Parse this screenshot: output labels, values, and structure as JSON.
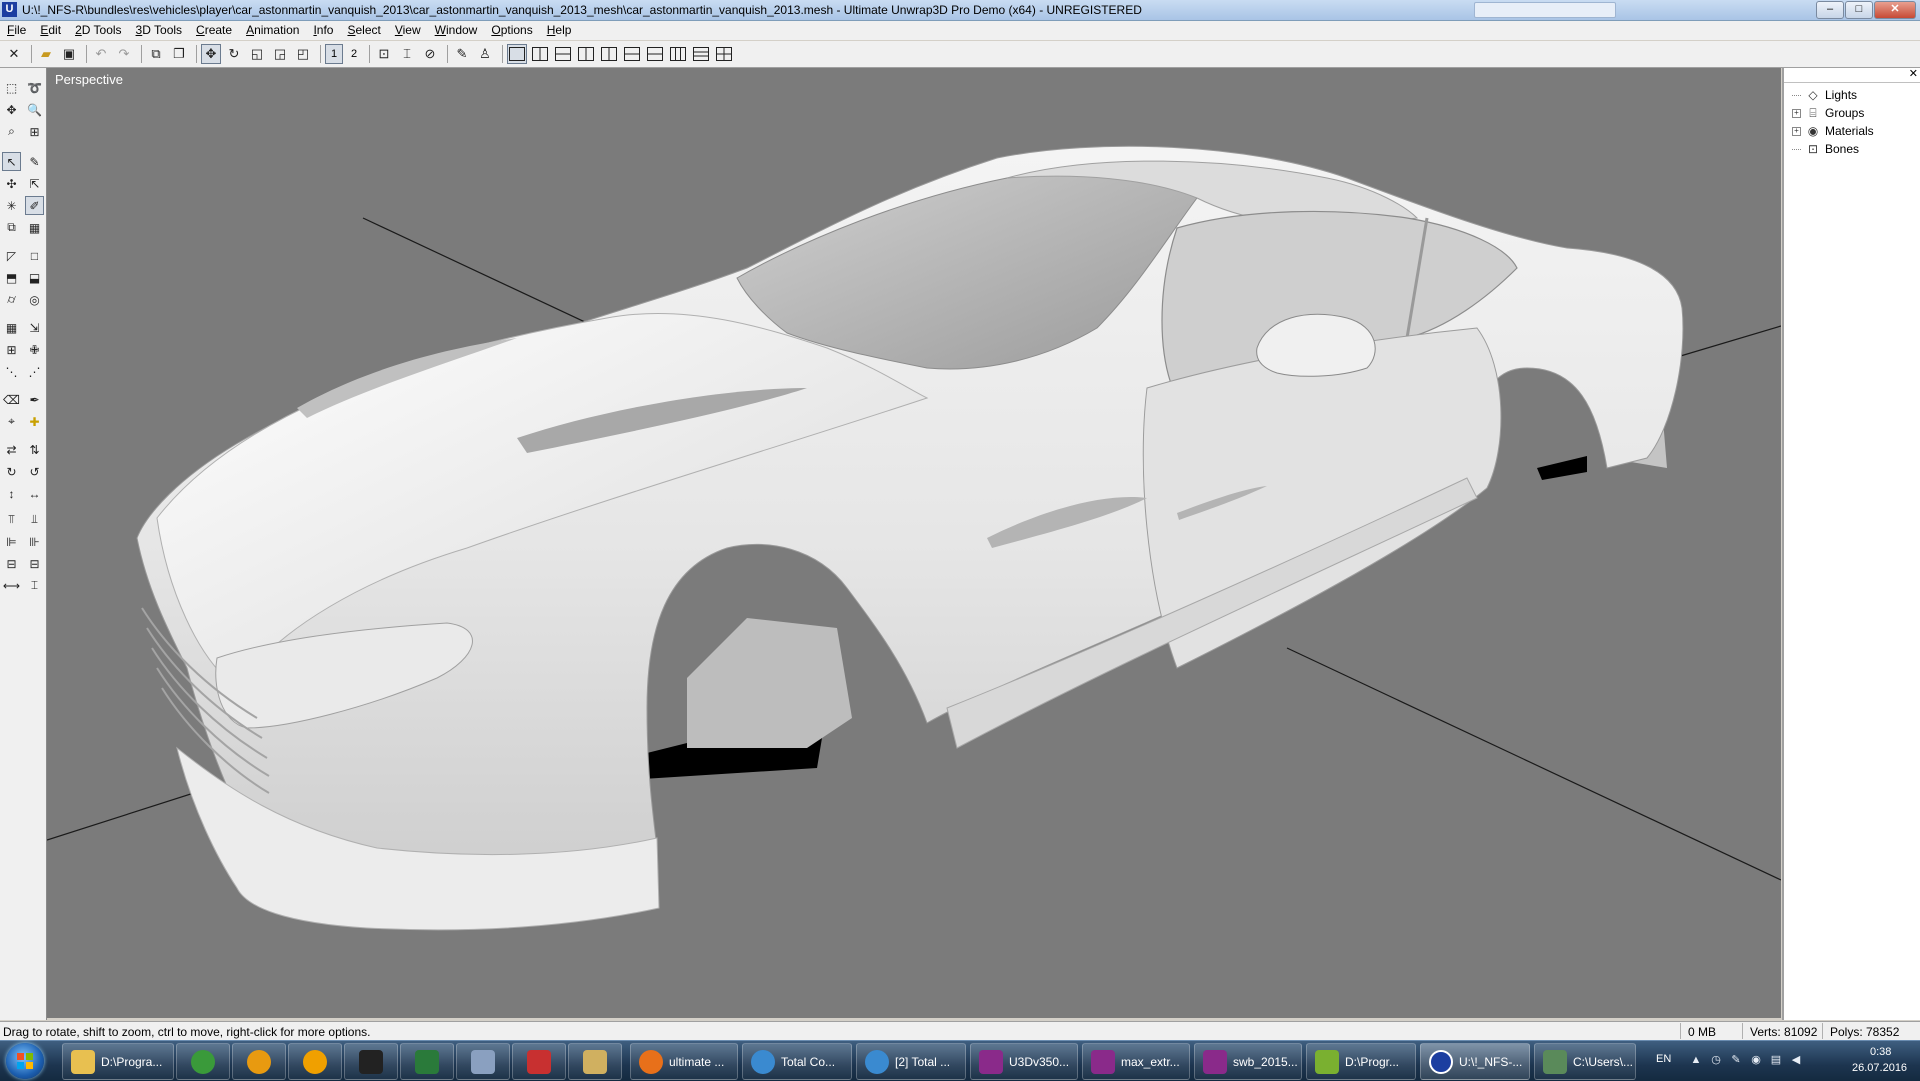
{
  "window": {
    "title": "U:\\!_NFS-R\\bundles\\res\\vehicles\\player\\car_astonmartin_vanquish_2013\\car_astonmartin_vanquish_2013_mesh\\car_astonmartin_vanquish_2013.mesh - Ultimate Unwrap3D Pro Demo (x64) - UNREGISTERED",
    "icon_letter": "U",
    "controls": {
      "minimize": "–",
      "maximize": "□",
      "close": "✕"
    }
  },
  "menu": [
    "File",
    "Edit",
    "2D Tools",
    "3D Tools",
    "Create",
    "Animation",
    "Info",
    "Select",
    "View",
    "Window",
    "Options",
    "Help"
  ],
  "toolbar": {
    "view_numbers": [
      "1",
      "2"
    ],
    "icons": [
      "new-icon",
      "open-icon",
      "save-icon",
      "undo-icon",
      "redo-icon",
      "export-icon",
      "copy-icon",
      "move-icon",
      "rotate-icon",
      "scale-icon",
      "scale-uniform-icon",
      "transform-icon"
    ]
  },
  "viewport": {
    "label": "Perspective",
    "background": "#7b7b7b",
    "model": "car_astonmartin_vanquish_2013 (white shaded body)"
  },
  "scene_tree": {
    "close": "✕",
    "items": [
      {
        "label": "Lights",
        "icon": "light-icon",
        "expandable": false
      },
      {
        "label": "Groups",
        "icon": "groups-icon",
        "expandable": true
      },
      {
        "label": "Materials",
        "icon": "materials-icon",
        "expandable": true
      },
      {
        "label": "Bones",
        "icon": "bones-icon",
        "expandable": false
      }
    ]
  },
  "status": {
    "hint": "Drag to rotate, shift to zoom, ctrl to move, right-click for more options.",
    "memory": "0 MB",
    "verts": "Verts: 81092",
    "polys": "Polys: 78352"
  },
  "taskbar": {
    "tasks": [
      {
        "label": "D:\\Progra...",
        "color": "#e8c050"
      },
      {
        "label": "",
        "color": "#3a9a3a",
        "pinned": true
      },
      {
        "label": "",
        "color": "#e89a10",
        "pinned": true
      },
      {
        "label": "",
        "color": "#f0a000",
        "pinned": true
      },
      {
        "label": "",
        "color": "#222222",
        "pinned": true
      },
      {
        "label": "",
        "color": "#2a7a3a",
        "pinned": true
      },
      {
        "label": "",
        "color": "#8aa0c0",
        "pinned": true
      },
      {
        "label": "",
        "color": "#c83030",
        "pinned": true
      },
      {
        "label": "",
        "color": "#d0b060",
        "pinned": true
      },
      {
        "label": "ultimate ...",
        "color": "#e8701a"
      },
      {
        "label": "Total Co...",
        "color": "#3a8ad0"
      },
      {
        "label": "[2] Total ...",
        "color": "#3a8ad0"
      },
      {
        "label": "U3Dv350...",
        "color": "#8a2a8a"
      },
      {
        "label": "max_extr...",
        "color": "#8a2a8a"
      },
      {
        "label": "swb_2015...",
        "color": "#8a2a8a"
      },
      {
        "label": "D:\\Progr...",
        "color": "#7ab030"
      },
      {
        "label": "U:\\!_NFS-...",
        "color": "#1c3ea0"
      },
      {
        "label": "C:\\Users\\...",
        "color": "#5a8a5a"
      }
    ],
    "language": "EN",
    "time": "0:38",
    "date": "26.07.2016"
  }
}
